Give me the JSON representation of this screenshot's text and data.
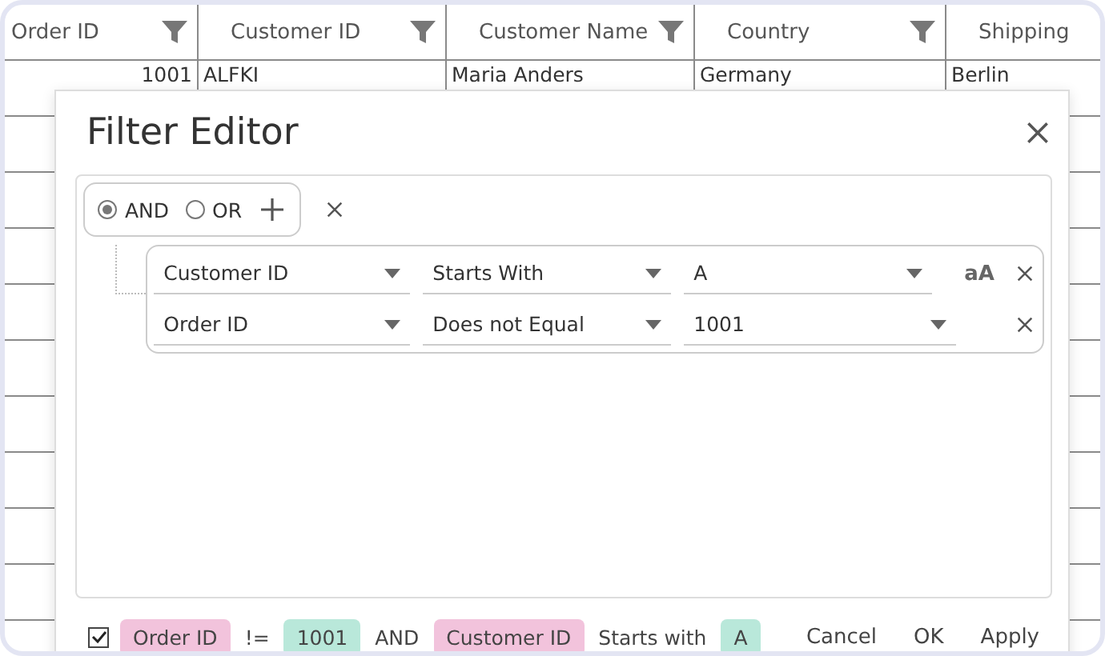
{
  "grid": {
    "columns": [
      {
        "label": "Order ID",
        "filter": true
      },
      {
        "label": "Customer ID",
        "filter": true
      },
      {
        "label": "Customer Name",
        "filter": true
      },
      {
        "label": "Country",
        "filter": true
      },
      {
        "label": "Shipping",
        "filter": false
      }
    ],
    "rows": [
      {
        "cells": [
          "1001",
          "ALFKI",
          "Maria Anders",
          "Germany",
          "Berlin"
        ]
      }
    ]
  },
  "dialog": {
    "title": "Filter Editor",
    "group": {
      "operators": [
        {
          "label": "AND",
          "selected": true
        },
        {
          "label": "OR",
          "selected": false
        }
      ]
    },
    "conditions": [
      {
        "field": "Customer ID",
        "operator": "Starts With",
        "value": "A",
        "match_case": "aA"
      },
      {
        "field": "Order ID",
        "operator": "Does not Equal",
        "value": "1001"
      }
    ],
    "footer": {
      "enabled": true,
      "tokens": [
        {
          "kind": "field",
          "text": "Order ID"
        },
        {
          "kind": "op",
          "text": "!="
        },
        {
          "kind": "value",
          "text": "1001"
        },
        {
          "kind": "logic",
          "text": "AND"
        },
        {
          "kind": "field",
          "text": "Customer ID"
        },
        {
          "kind": "op",
          "text": "Starts with"
        },
        {
          "kind": "value",
          "text": "A"
        }
      ],
      "buttons": [
        "Cancel",
        "OK",
        "Apply"
      ]
    }
  }
}
